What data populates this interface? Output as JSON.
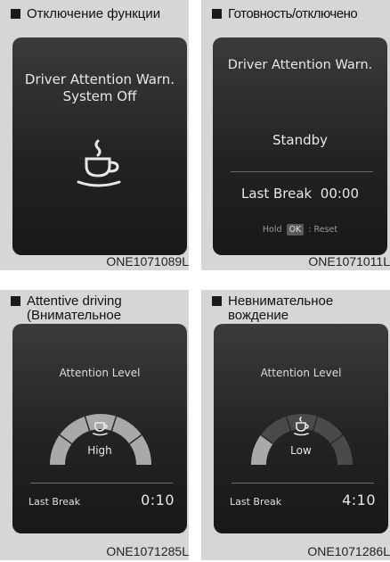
{
  "panels": [
    {
      "caption": "Отключение функции",
      "title_line1": "Driver Attention Warn.",
      "title_line2": "System Off",
      "icon": "coffee-cup-icon",
      "code": "ONE1071089L"
    },
    {
      "caption": "Готовность/отключено",
      "title": "Driver Attention Warn.",
      "status": "Standby",
      "last_break_label": "Last Break",
      "last_break_time": "00:00",
      "hold_label": "Hold",
      "ok_label": "OK",
      "reset_label": ": Reset",
      "code": "ONE1071011L"
    },
    {
      "caption": "Attentive driving\n(Внимательное\nвождение)",
      "title": "Attention Level",
      "level_label": "High",
      "level": 1.0,
      "last_break_label": "Last Break",
      "last_break_time": "0:10",
      "icon": "coffee-cup-icon",
      "code": "ONE1071285L"
    },
    {
      "caption": "Невнимательное\nвождение",
      "title": "Attention Level",
      "level_label": "Low",
      "level": 0.2,
      "last_break_label": "Last Break",
      "last_break_time": "4:10",
      "icon": "coffee-cup-icon",
      "code": "ONE1071286L"
    }
  ],
  "colors": {
    "screen_bg": "#262626",
    "gauge_active": "#a9a9a9",
    "gauge_inactive": "#4a4a4a",
    "text": "#e8e8e8",
    "panel_bg": "#d6d6d6"
  }
}
